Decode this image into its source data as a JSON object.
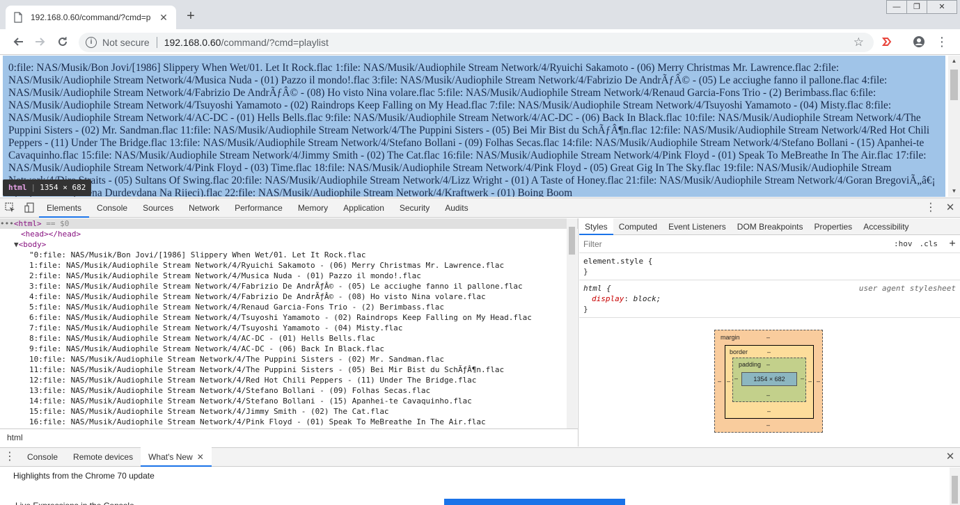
{
  "browser": {
    "tab_title": "192.168.0.60/command/?cmd=p",
    "tab_close": "✕",
    "new_tab": "+",
    "window_controls": [
      "—",
      "❐",
      "✕"
    ],
    "security_label": "Not secure",
    "url_host": "192.168.0.60",
    "url_path": "/command/?cmd=playlist"
  },
  "page": {
    "text": "0:file: NAS/Musik/Bon Jovi/[1986] Slippery When Wet/01. Let It Rock.flac 1:file: NAS/Musik/Audiophile Stream Network/4/Ryuichi Sakamoto - (06) Merry Christmas Mr. Lawrence.flac 2:file: NAS/Musik/Audiophile Stream Network/4/Musica Nuda - (01) Pazzo il mondo!.flac 3:file: NAS/Musik/Audiophile Stream Network/4/Fabrizio De AndrÃƒÂ© - (05) Le acciughe fanno il pallone.flac 4:file: NAS/Musik/Audiophile Stream Network/4/Fabrizio De AndrÃƒÂ© - (08) Ho visto Nina volare.flac 5:file: NAS/Musik/Audiophile Stream Network/4/Renaud Garcia-Fons Trio - (2) Berimbass.flac 6:file: NAS/Musik/Audiophile Stream Network/4/Tsuyoshi Yamamoto - (02) Raindrops Keep Falling on My Head.flac 7:file: NAS/Musik/Audiophile Stream Network/4/Tsuyoshi Yamamoto - (04) Misty.flac 8:file: NAS/Musik/Audiophile Stream Network/4/AC-DC - (01) Hells Bells.flac 9:file: NAS/Musik/Audiophile Stream Network/4/AC-DC - (06) Back In Black.flac 10:file: NAS/Musik/Audiophile Stream Network/4/The Puppini Sisters - (02) Mr. Sandman.flac 11:file: NAS/Musik/Audiophile Stream Network/4/The Puppini Sisters - (05) Bei Mir Bist du SchÃƒÂ¶n.flac 12:file: NAS/Musik/Audiophile Stream Network/4/Red Hot Chili Peppers - (11) Under The Bridge.flac 13:file: NAS/Musik/Audiophile Stream Network/4/Stefano Bollani - (09) Folhas Secas.flac 14:file: NAS/Musik/Audiophile Stream Network/4/Stefano Bollani - (15) Apanhei-te Cavaquinho.flac 15:file: NAS/Musik/Audiophile Stream Network/4/Jimmy Smith - (02) The Cat.flac 16:file: NAS/Musik/Audiophile Stream Network/4/Pink Floyd - (01) Speak To MeBreathe In The Air.flac 17:file: NAS/Musik/Audiophile Stream Network/4/Pink Floyd - (03) Time.flac 18:file: NAS/Musik/Audiophile Stream Network/4/Pink Floyd - (05) Great Gig In The Sky.flac 19:file: NAS/Musik/Audiophile Stream Network/4/Dire Straits - (05) Sultans Of Swing.flac 20:file: NAS/Musik/Audiophile Stream Network/4/Lizz Wright - (01) A Taste of Honey.flac 21:file: NAS/Musik/Audiophile Stream Network/4/Goran BregoviÃ„â€¡ - (02) Ederlezi (Scena Durdevdana Na Rijeci).flac 22:file: NAS/Musik/Audiophile Stream Network/4/Kraftwerk - (01) Boing Boom"
  },
  "tooltip": {
    "tag": "html",
    "size": "1354 × 682"
  },
  "devtools": {
    "tabs": [
      "Elements",
      "Console",
      "Sources",
      "Network",
      "Performance",
      "Memory",
      "Application",
      "Security",
      "Audits"
    ],
    "dom": {
      "html_line": "<html> == $0",
      "html_open": "<html>",
      "selected_marker": "== $0",
      "head_line": "<head></head>",
      "body_line": "<body>",
      "lines": [
        "\"0:file: NAS/Musik/Bon Jovi/[1986] Slippery When Wet/01. Let It Rock.flac",
        "1:file: NAS/Musik/Audiophile Stream Network/4/Ryuichi Sakamoto - (06) Merry Christmas Mr. Lawrence.flac",
        "2:file: NAS/Musik/Audiophile Stream Network/4/Musica Nuda - (01) Pazzo il mondo!.flac",
        "3:file: NAS/Musik/Audiophile Stream Network/4/Fabrizio De AndrÃƒÂ© - (05) Le acciughe fanno il pallone.flac",
        "4:file: NAS/Musik/Audiophile Stream Network/4/Fabrizio De AndrÃƒÂ© - (08) Ho visto Nina volare.flac",
        "5:file: NAS/Musik/Audiophile Stream Network/4/Renaud Garcia-Fons Trio - (2) Berimbass.flac",
        "6:file: NAS/Musik/Audiophile Stream Network/4/Tsuyoshi Yamamoto - (02) Raindrops Keep Falling on My Head.flac",
        "7:file: NAS/Musik/Audiophile Stream Network/4/Tsuyoshi Yamamoto - (04) Misty.flac",
        "8:file: NAS/Musik/Audiophile Stream Network/4/AC-DC - (01) Hells Bells.flac",
        "9:file: NAS/Musik/Audiophile Stream Network/4/AC-DC - (06) Back In Black.flac",
        "10:file: NAS/Musik/Audiophile Stream Network/4/The Puppini Sisters - (02) Mr. Sandman.flac",
        "11:file: NAS/Musik/Audiophile Stream Network/4/The Puppini Sisters - (05) Bei Mir Bist du SchÃƒÂ¶n.flac",
        "12:file: NAS/Musik/Audiophile Stream Network/4/Red Hot Chili Peppers - (11) Under The Bridge.flac",
        "13:file: NAS/Musik/Audiophile Stream Network/4/Stefano Bollani - (09) Folhas Secas.flac",
        "14:file: NAS/Musik/Audiophile Stream Network/4/Stefano Bollani - (15) Apanhei-te Cavaquinho.flac",
        "15:file: NAS/Musik/Audiophile Stream Network/4/Jimmy Smith - (02) The Cat.flac",
        "16:file: NAS/Musik/Audiophile Stream Network/4/Pink Floyd - (01) Speak To MeBreathe In The Air.flac"
      ]
    },
    "breadcrumb": "html",
    "styles": {
      "tabs": [
        "Styles",
        "Computed",
        "Event Listeners",
        "DOM Breakpoints",
        "Properties",
        "Accessibility"
      ],
      "filter_placeholder": "Filter",
      "hov": ":hov",
      "cls": ".cls",
      "plus": "+",
      "element_style": "element.style {",
      "close_brace": "}",
      "html_selector": "html {",
      "ua_source": "user agent stylesheet",
      "display_prop": "display",
      "display_val": "block;"
    },
    "boxmodel": {
      "margin_label": "margin",
      "border_label": "border",
      "padding_label": "padding",
      "content_size": "1354 × 682",
      "dash": "–"
    },
    "drawer": {
      "tabs": [
        "Console",
        "Remote devices",
        "What's New"
      ],
      "close": "✕",
      "headline": "Highlights from the Chrome 70 update",
      "subline": "Live Expressions in the Console"
    }
  }
}
